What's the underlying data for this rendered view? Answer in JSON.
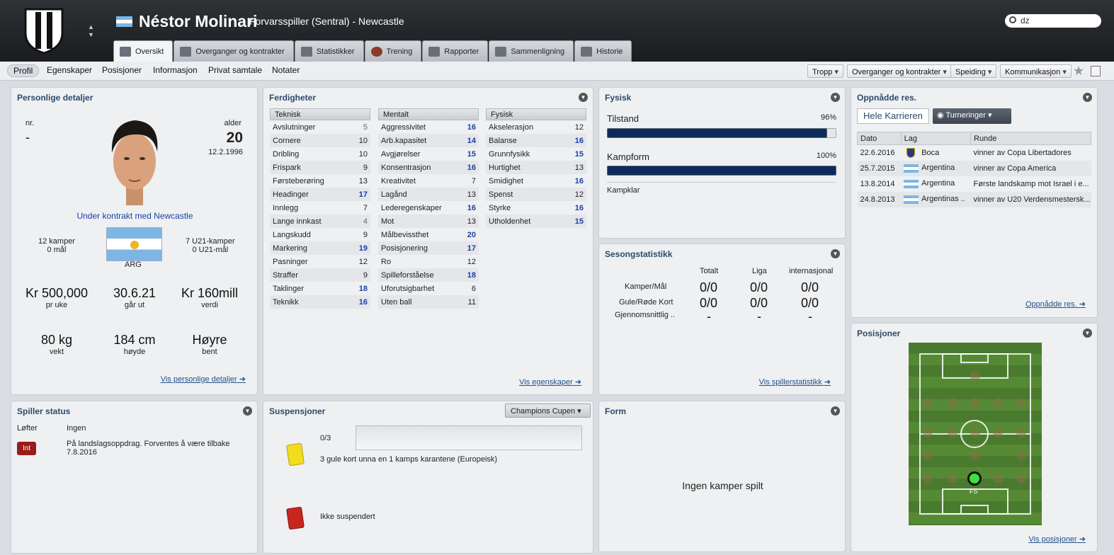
{
  "header": {
    "name": "Néstor Molinari",
    "subtitle": "Forvarsspiller (Sentral) - Newcastle",
    "search_value": "dz",
    "tabs": [
      "Oversikt",
      "Overganger og kontrakter",
      "Statistikker",
      "Trening",
      "Rapporter",
      "Sammenligning",
      "Historie"
    ]
  },
  "subnav": {
    "items": [
      "Profil",
      "Egenskaper",
      "Posisjoner",
      "Informasjon",
      "Privat samtale",
      "Notater"
    ],
    "dropdowns": [
      "Tropp",
      "Overganger og kontrakter",
      "Speiding",
      "Kommunikasjon"
    ]
  },
  "personal": {
    "title": "Personlige detaljer",
    "nr_label": "nr.",
    "nr": "-",
    "age_label": "alder",
    "age": "20",
    "dob": "12.2.1996",
    "contract": "Under kontrakt med Newcastle",
    "caps": "12 kamper",
    "goals": "0 mål",
    "u21_caps": "7 U21-kamper",
    "u21_goals": "0 U21-mål",
    "nation": "ARG",
    "wage": "Kr 500,000",
    "wage_lbl": "pr uke",
    "expires": "30.6.21",
    "expires_lbl": "går ut",
    "value": "Kr 160mill",
    "value_lbl": "verdi",
    "weight": "80 kg",
    "weight_lbl": "vekt",
    "height": "184 cm",
    "height_lbl": "høyde",
    "foot": "Høyre",
    "foot_lbl": "bent",
    "link": "Vis personlige detaljer"
  },
  "skills": {
    "title": "Ferdigheter",
    "link": "Vis egenskaper",
    "technical": {
      "header": "Teknisk",
      "rows": [
        [
          "Avslutninger",
          "5"
        ],
        [
          "Cornere",
          "10"
        ],
        [
          "Dribling",
          "10"
        ],
        [
          "Frispark",
          "9"
        ],
        [
          "Førsteberøring",
          "13"
        ],
        [
          "Headinger",
          "17"
        ],
        [
          "Innlegg",
          "7"
        ],
        [
          "Lange innkast",
          "4"
        ],
        [
          "Langskudd",
          "9"
        ],
        [
          "Markering",
          "19"
        ],
        [
          "Pasninger",
          "12"
        ],
        [
          "Straffer",
          "9"
        ],
        [
          "Taklinger",
          "18"
        ],
        [
          "Teknikk",
          "16"
        ]
      ]
    },
    "mental": {
      "header": "Mentalt",
      "rows": [
        [
          "Aggressivitet",
          "16"
        ],
        [
          "Arb.kapasitet",
          "14"
        ],
        [
          "Avgjørelser",
          "15"
        ],
        [
          "Konsentrasjon",
          "16"
        ],
        [
          "Kreativitet",
          "7"
        ],
        [
          "Lagånd",
          "13"
        ],
        [
          "Lederegenskaper",
          "16"
        ],
        [
          "Mot",
          "13"
        ],
        [
          "Målbevissthet",
          "20"
        ],
        [
          "Posisjonering",
          "17"
        ],
        [
          "Ro",
          "12"
        ],
        [
          "Spilleforståelse",
          "18"
        ],
        [
          "Uforutsigbarhet",
          "6"
        ],
        [
          "Uten ball",
          "11"
        ]
      ]
    },
    "physical": {
      "header": "Fysisk",
      "rows": [
        [
          "Akselerasjon",
          "12"
        ],
        [
          "Balanse",
          "16"
        ],
        [
          "Grunnfysikk",
          "15"
        ],
        [
          "Hurtighet",
          "13"
        ],
        [
          "Smidighet",
          "16"
        ],
        [
          "Spenst",
          "12"
        ],
        [
          "Styrke",
          "16"
        ],
        [
          "Utholdenhet",
          "15"
        ]
      ]
    }
  },
  "fysisk": {
    "title": "Fysisk",
    "condition_lbl": "Tilstand",
    "condition": "96%",
    "condition_frac": 0.96,
    "form_lbl": "Kampform",
    "form": "100%",
    "form_frac": 1.0,
    "status": "Kampklar"
  },
  "season": {
    "title": "Sesongstatistikk",
    "cols": [
      "Totalt",
      "Liga",
      "internasjonal"
    ],
    "rows": [
      {
        "label": "Kamper/Mål",
        "vals": [
          "0/0",
          "0/0",
          "0/0"
        ]
      },
      {
        "label": "Gule/Røde Kort",
        "vals": [
          "0/0",
          "0/0",
          "0/0"
        ]
      },
      {
        "label": "Gjennomsnittlig ..",
        "vals": [
          "-",
          "-",
          "-"
        ]
      }
    ],
    "link": "Vis spillerstatistikk"
  },
  "achievements": {
    "title": "Oppnådde res.",
    "btn_career": "Hele Karrieren",
    "btn_tourn": "Turneringer",
    "cols": [
      "Dato",
      "Lag",
      "Runde"
    ],
    "rows": [
      {
        "date": "22.6.2016",
        "team": "Boca",
        "round": "vinner av Copa Libertadores",
        "flag": "boca"
      },
      {
        "date": "25.7.2015",
        "team": "Argentina",
        "round": "vinner av Copa America",
        "flag": "arg"
      },
      {
        "date": "13.8.2014",
        "team": "Argentina",
        "round": "Første landskamp mot Israel i e...",
        "flag": "arg"
      },
      {
        "date": "24.8.2013",
        "team": "Argentinas ..",
        "round": "vinner av U20 Verdensmestersk...",
        "flag": "arg"
      }
    ],
    "link": "Oppnådde res."
  },
  "positions": {
    "title": "Posisjoner",
    "pos_label": "FS",
    "link": "Vis posisjoner"
  },
  "status": {
    "title": "Spiller status",
    "k1": "Løfter",
    "v1": "Ingen",
    "badge": "Int",
    "note": "På landslagsoppdrag. Forventes å være tilbake 7.8.2016"
  },
  "susp": {
    "title": "Suspensjoner",
    "competition": "Champions Cupen",
    "count": "0/3",
    "yellow_text": "3 gule kort unna en 1 kamps karantene (Europeisk)",
    "red_text": "Ikke suspendert"
  },
  "form": {
    "title": "Form",
    "empty": "Ingen kamper spilt"
  },
  "colors": {
    "accent": "#2d4a6b",
    "high_attr": "#1a3fa6",
    "pitch": "#4f8432"
  }
}
